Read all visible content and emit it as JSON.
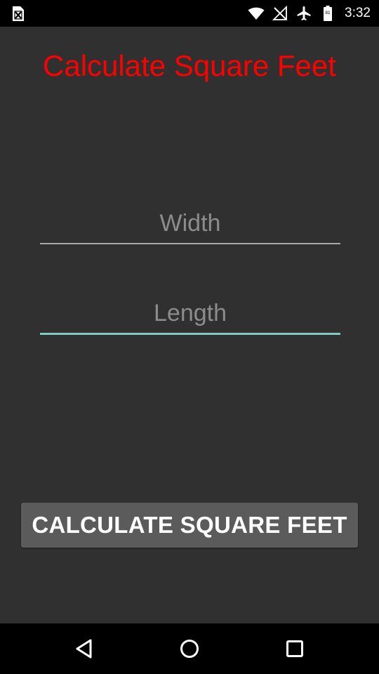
{
  "status_bar": {
    "time": "3:32",
    "battery_level": "81",
    "icons": [
      "sim-card-icon",
      "wifi-icon",
      "no-signal-icon",
      "airplane-mode-icon",
      "battery-icon"
    ]
  },
  "app": {
    "title": "Calculate Square Feet",
    "title_color": "#ff0000",
    "width_placeholder": "Width",
    "length_placeholder": "Length",
    "focus_accent": "#80cbc4",
    "calculate_button_label": "CALCULATE SQUARE FEET"
  },
  "nav_bar": {
    "icons": [
      "back-icon",
      "home-icon",
      "recents-icon"
    ]
  }
}
